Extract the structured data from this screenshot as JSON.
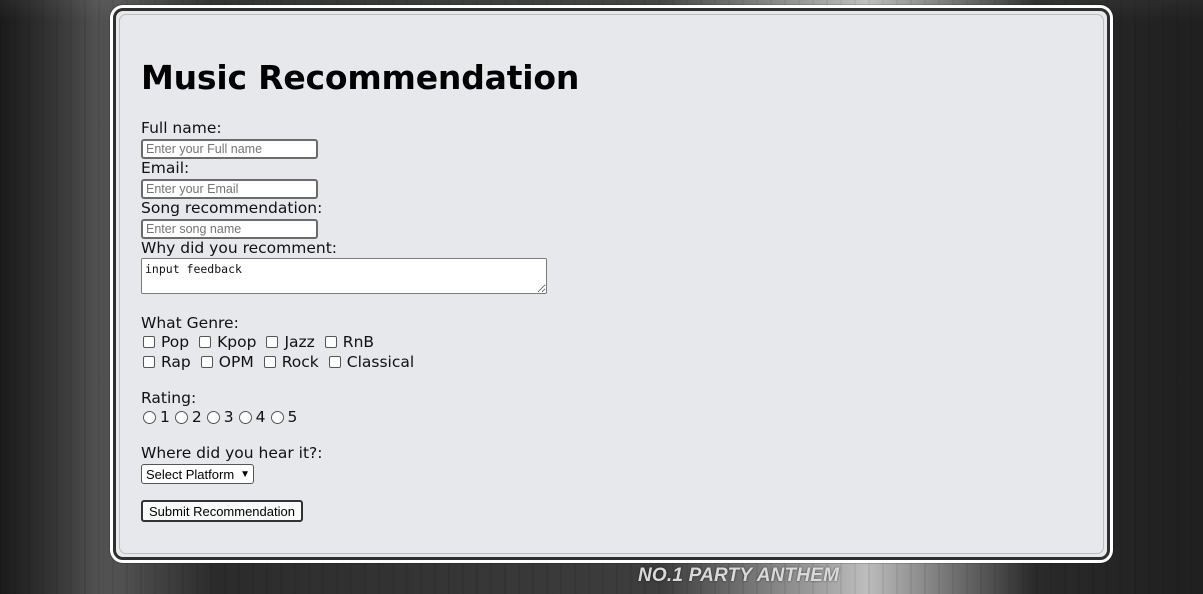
{
  "background": {
    "poster_text": "NO.1 PARTY ANTHEM"
  },
  "form": {
    "title": "Music Recommendation",
    "full_name": {
      "label": "Full name:",
      "placeholder": "Enter your Full name",
      "value": ""
    },
    "email": {
      "label": "Email:",
      "placeholder": "Enter your Email",
      "value": ""
    },
    "song": {
      "label": "Song recommendation:",
      "placeholder": "Enter song name",
      "value": ""
    },
    "why": {
      "label": "Why did you recomment:",
      "value": "input feedback"
    },
    "genre": {
      "label": "What Genre:",
      "row1": [
        "Pop",
        "Kpop",
        "Jazz",
        "RnB"
      ],
      "row2": [
        "Rap",
        "OPM",
        "Rock",
        "Classical"
      ],
      "checked": []
    },
    "rating": {
      "label": "Rating:",
      "options": [
        "1",
        "2",
        "3",
        "4",
        "5"
      ],
      "selected": null
    },
    "platform": {
      "label": "Where did you hear it?:",
      "selected": "Select Platform"
    },
    "submit_label": "Submit Recommendation"
  },
  "colors": {
    "card_bg": "#e7e8ec",
    "card_border": "#2f2f2f",
    "text": "#111111"
  }
}
